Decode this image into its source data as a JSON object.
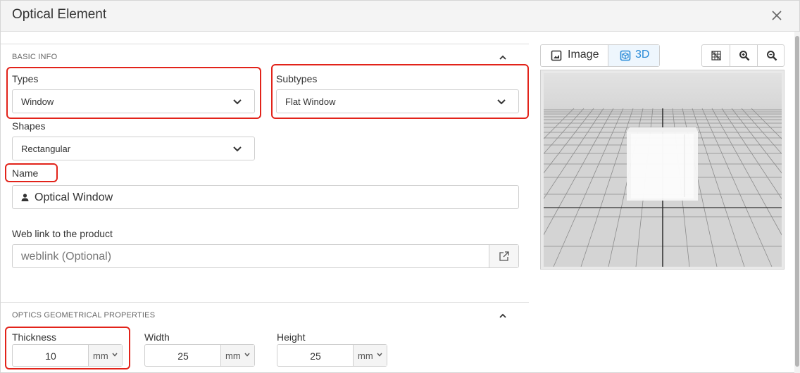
{
  "dialog": {
    "title": "Optical Element"
  },
  "basic_info": {
    "section_title": "BASIC INFO",
    "types": {
      "label": "Types",
      "value": "Window"
    },
    "subtypes": {
      "label": "Subtypes",
      "value": "Flat Window"
    },
    "shapes": {
      "label": "Shapes",
      "value": "Rectangular"
    },
    "name": {
      "label": "Name",
      "value": "Optical Window"
    },
    "weblink": {
      "label": "Web link to the product",
      "placeholder": "weblink (Optional)"
    }
  },
  "geometry": {
    "section_title": "OPTICS GEOMETRICAL PROPERTIES",
    "thickness": {
      "label": "Thickness",
      "value": "10",
      "unit": "mm"
    },
    "width": {
      "label": "Width",
      "value": "25",
      "unit": "mm"
    },
    "height": {
      "label": "Height",
      "value": "25",
      "unit": "mm"
    }
  },
  "preview": {
    "image_label": "Image",
    "threed_label": "3D",
    "active_view": "3D",
    "accent_color": "#2a8bd8",
    "highlight_color": "#e2231a",
    "icons": [
      "image-icon",
      "cube-icon",
      "grid-icon",
      "zoom-in-icon",
      "zoom-out-icon"
    ]
  }
}
